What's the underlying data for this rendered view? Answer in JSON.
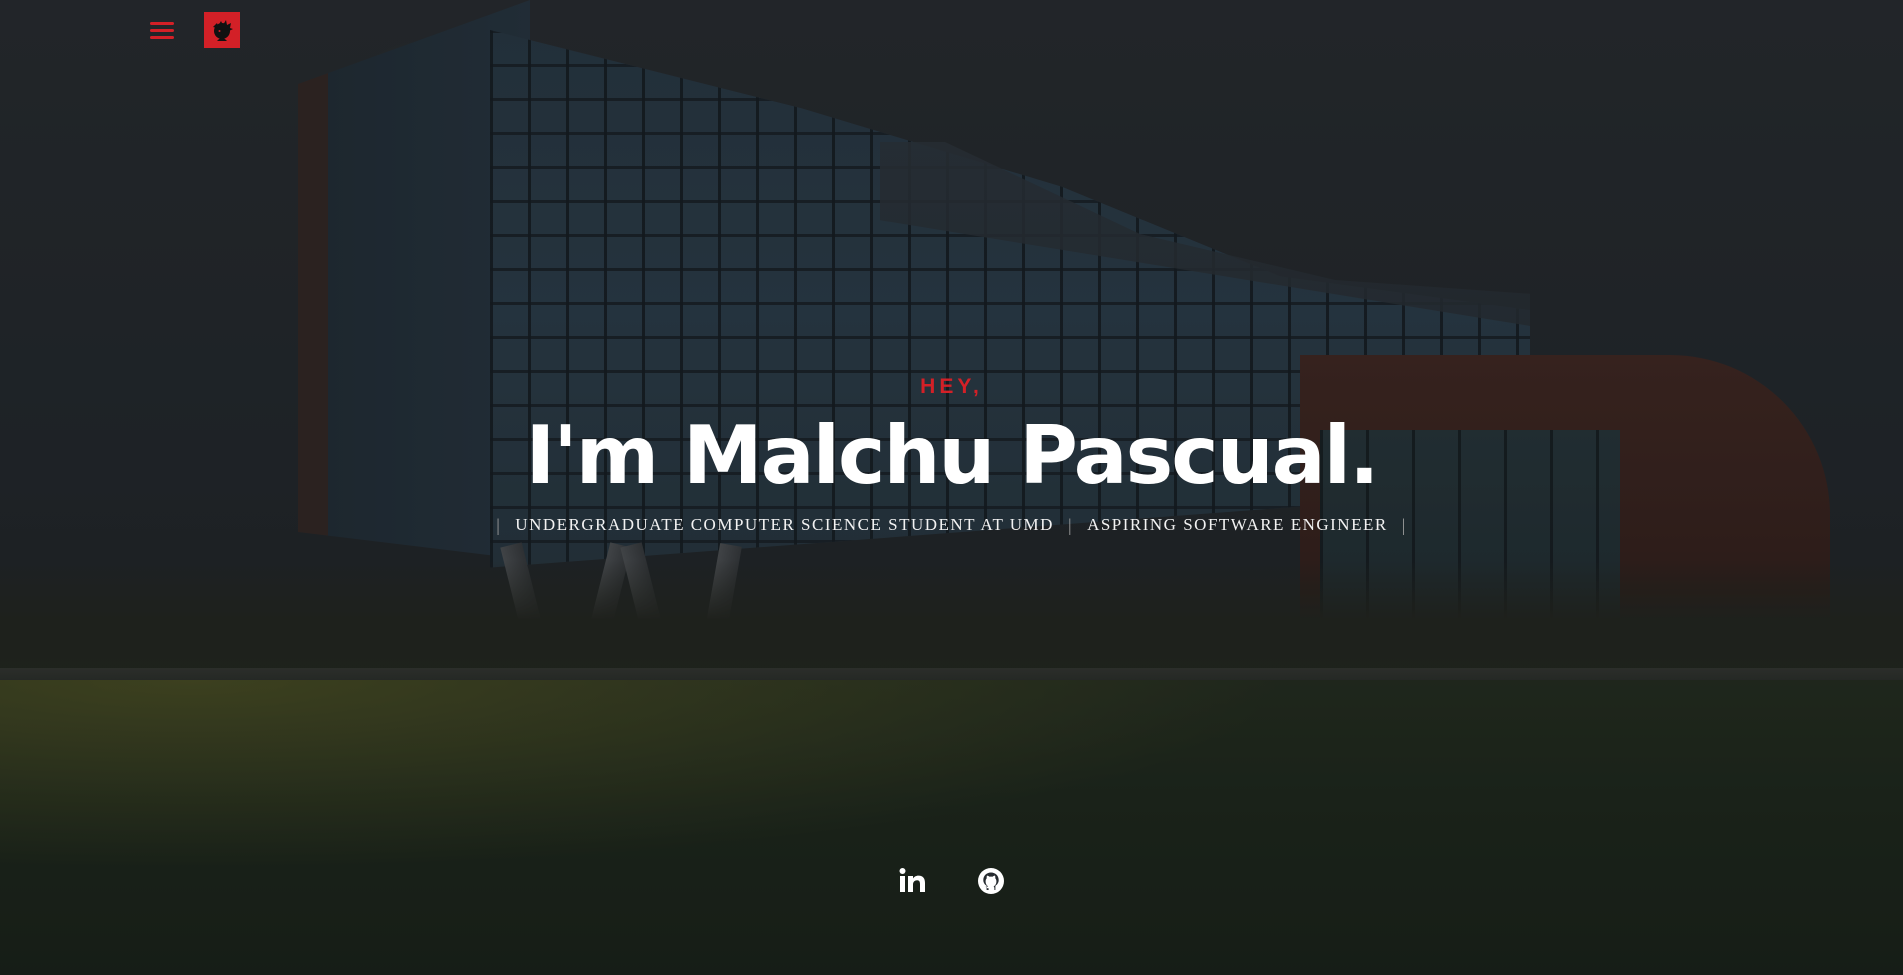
{
  "header": {
    "menu_icon": "hamburger-menu-icon",
    "logo_icon": "avatar-logo-icon"
  },
  "intro": {
    "greeting": "HEY,",
    "name": "I'm Malchu Pascual.",
    "roles": [
      "UNDERGRADUATE COMPUTER SCIENCE STUDENT AT UMD",
      "ASPIRING SOFTWARE ENGINEER"
    ],
    "separator": "|"
  },
  "social": {
    "items": [
      {
        "icon": "linkedin-icon"
      },
      {
        "icon": "github-icon"
      }
    ]
  },
  "colors": {
    "accent": "#d32027",
    "text": "#ffffff",
    "background": "#262b30"
  }
}
